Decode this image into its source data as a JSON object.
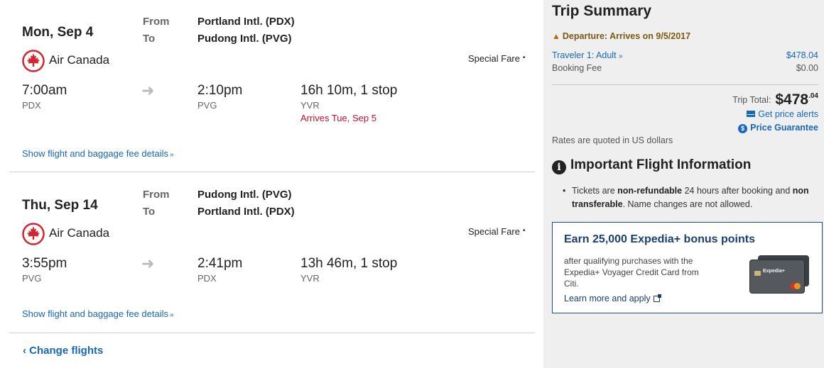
{
  "legs": [
    {
      "date": "Mon, Sep 4",
      "from_label": "From",
      "to_label": "To",
      "from_airport": "Portland Intl. (PDX)",
      "to_airport": "Pudong Intl. (PVG)",
      "airline": "Air Canada",
      "fare": "Special Fare",
      "depart_time": "7:00am",
      "depart_code": "PDX",
      "arrive_time": "2:10pm",
      "arrive_code": "PVG",
      "duration": "16h 10m, 1 stop",
      "stop_code": "YVR",
      "arrival_note": "Arrives Tue, Sep 5",
      "details_link": "Show flight and baggage fee details"
    },
    {
      "date": "Thu, Sep 14",
      "from_label": "From",
      "to_label": "To",
      "from_airport": "Pudong Intl. (PVG)",
      "to_airport": "Portland Intl. (PDX)",
      "airline": "Air Canada",
      "fare": "Special Fare",
      "depart_time": "3:55pm",
      "depart_code": "PVG",
      "arrive_time": "2:41pm",
      "arrive_code": "PDX",
      "duration": "13h 46m, 1 stop",
      "stop_code": "YVR",
      "details_link": "Show flight and baggage fee details"
    }
  ],
  "change_flights": "Change flights",
  "summary": {
    "title": "Trip Summary",
    "departure_warning": "Departure: Arrives on 9/5/2017",
    "traveler_label": "Traveler 1: Adult",
    "traveler_price": "$478.04",
    "fee_label": "Booking Fee",
    "fee_value": "$0.00",
    "total_label": "Trip Total:",
    "total_main": "$478",
    "total_cents": ".04",
    "price_alerts": "Get price alerts",
    "price_guarantee": "Price Guarantee",
    "rates_note": "Rates are quoted in US dollars"
  },
  "important_info": {
    "heading": "Important Flight Information",
    "text_1": "Tickets are ",
    "bold_1": "non-refundable",
    "text_2": " 24 hours after booking and ",
    "bold_2": "non transferable",
    "text_3": ". Name changes are not allowed."
  },
  "promo": {
    "title": "Earn 25,000 Expedia+ bonus points",
    "body": "after qualifying purchases with the Expedia+ Voyager Credit Card from Citi.",
    "link": "Learn more and apply",
    "card_brand": "Expedia+"
  },
  "colors": {
    "link": "#1668b8",
    "alert_red": "#c8102e",
    "warning": "#7a5a10",
    "panel_bg": "#efefef",
    "promo_border": "#1a4e8a",
    "air_canada_red": "#d22630"
  },
  "icons": {
    "airline_logo": "air-canada-maple-leaf-icon",
    "flight_arrow": "right-arrow-icon",
    "expand": "chevron-down-double-icon",
    "back": "chevron-left-icon",
    "warning": "warning-triangle-icon",
    "email": "envelope-icon",
    "guarantee": "dollar-circle-icon",
    "info": "info-circle-icon",
    "external": "external-link-icon"
  }
}
